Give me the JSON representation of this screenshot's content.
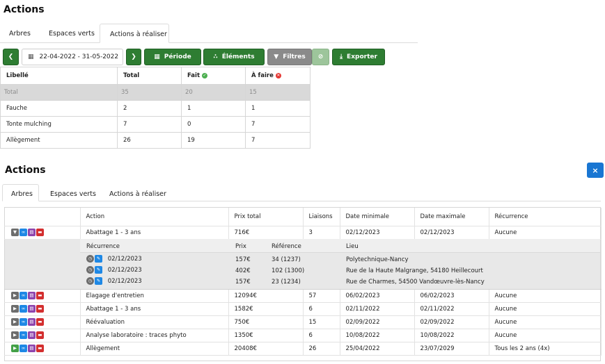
{
  "top": {
    "title": "Actions",
    "tabs": [
      {
        "label": "Arbres"
      },
      {
        "label": "Espaces verts"
      },
      {
        "label": "Actions à réaliser"
      }
    ],
    "toolbar": {
      "date_range": "22-04-2022 - 31-05-2022",
      "periode": "Période",
      "elements": "Éléments",
      "filtres": "Filtres",
      "exporter": "Exporter"
    },
    "table": {
      "headers": {
        "libelle": "Libellé",
        "total": "Total",
        "fait": "Fait",
        "a_faire": "À faire"
      },
      "total_row": {
        "libelle": "Total",
        "total": "35",
        "fait": "20",
        "a_faire": "15"
      },
      "rows": [
        {
          "libelle": "Fauche",
          "total": "2",
          "fait": "1",
          "a_faire": "1"
        },
        {
          "libelle": "Tonte mulching",
          "total": "7",
          "fait": "0",
          "a_faire": "7"
        },
        {
          "libelle": "Allègement",
          "total": "26",
          "fait": "19",
          "a_faire": "7"
        }
      ]
    }
  },
  "bottom": {
    "title": "Actions",
    "close": "×",
    "tabs": [
      {
        "label": "Arbres"
      },
      {
        "label": "Espaces verts"
      },
      {
        "label": "Actions à réaliser"
      }
    ],
    "table": {
      "headers": {
        "action": "Action",
        "prix_total": "Prix total",
        "liaisons": "Liaisons",
        "date_min": "Date minimale",
        "date_max": "Date maximale",
        "recurrence": "Récurrence"
      },
      "expanded_row": {
        "action": "Abattage 1 - 3 ans",
        "prix_total": "716€",
        "liaisons": "3",
        "date_min": "02/12/2023",
        "date_max": "02/12/2023",
        "recurrence": "Aucune"
      },
      "sub_headers": {
        "recurrence": "Récurrence",
        "prix": "Prix",
        "reference": "Référence",
        "lieu": "Lieu"
      },
      "sub_rows": [
        {
          "date": "02/12/2023",
          "prix": "157€",
          "reference": "34 (1237)",
          "lieu": "Polytechnique-Nancy"
        },
        {
          "date": "02/12/2023",
          "prix": "402€",
          "reference": "102 (1300)",
          "lieu": "Rue de la Haute Malgrange, 54180 Heillecourt"
        },
        {
          "date": "02/12/2023",
          "prix": "157€",
          "reference": "23 (1234)",
          "lieu": "Rue de Charmes, 54500 Vandœuvre-lès-Nancy"
        }
      ],
      "rows": [
        {
          "action": "Elagage d'entretien",
          "prix_total": "12094€",
          "liaisons": "57",
          "date_min": "06/02/2023",
          "date_max": "06/02/2023",
          "recurrence": "Aucune"
        },
        {
          "action": "Abattage 1 - 3 ans",
          "prix_total": "1582€",
          "liaisons": "6",
          "date_min": "02/11/2022",
          "date_max": "02/11/2022",
          "recurrence": "Aucune"
        },
        {
          "action": "Réévaluation",
          "prix_total": "750€",
          "liaisons": "15",
          "date_min": "02/09/2022",
          "date_max": "02/09/2022",
          "recurrence": "Aucune"
        },
        {
          "action": "Analyse laboratoire : traces phyto",
          "prix_total": "1350€",
          "liaisons": "6",
          "date_min": "10/08/2022",
          "date_max": "10/08/2022",
          "recurrence": "Aucune"
        },
        {
          "action": "Allègement",
          "prix_total": "20408€",
          "liaisons": "26",
          "date_min": "25/04/2022",
          "date_max": "23/07/2029",
          "recurrence": "Tous les 2 ans (4x)"
        }
      ]
    }
  },
  "colors": {
    "primary_green": "#2e7d32",
    "filter_grey": "#8a8a8a",
    "close_blue": "#1976d2",
    "total_row_grey": "#d9d9d9"
  }
}
